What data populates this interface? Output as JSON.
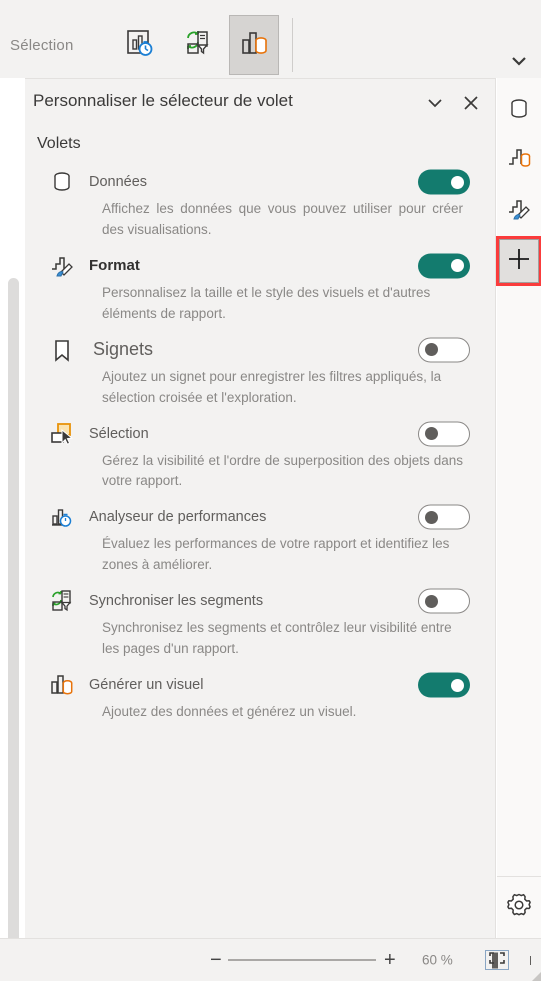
{
  "toolbar": {
    "label": "Sélection",
    "buttons": [
      {
        "name": "performance-analyzer-icon",
        "tooltip": "Analyseur de performances",
        "selected": false
      },
      {
        "name": "sync-slicers-icon",
        "tooltip": "Synchroniser les segments",
        "selected": false
      },
      {
        "name": "generate-visual-icon",
        "tooltip": "Générer un visuel",
        "selected": true
      }
    ],
    "collapse_chevron": "chevron-down-icon"
  },
  "panel": {
    "title": "Personnaliser le sélecteur de volet",
    "header_actions": [
      {
        "name": "collapse-icon",
        "glyph": "chevron-down"
      },
      {
        "name": "close-icon",
        "glyph": "close"
      }
    ],
    "section_title": "Volets",
    "panes": [
      {
        "id": "donnees",
        "label": "Données",
        "description": "Affichez les données que vous pouvez utiliser pour créer des visualisations.",
        "icon": "database-icon",
        "toggle": "on",
        "style": "normal"
      },
      {
        "id": "format",
        "label": "Format",
        "description": "Personnalisez la taille et le style des visuels et d'autres éléments de rapport.",
        "icon": "format-paintbrush-icon",
        "toggle": "on",
        "style": "bold"
      },
      {
        "id": "signets",
        "label": "Signets",
        "description": "Ajoutez un signet pour enregistrer les filtres appliqués, la sélection croisée et l'exploration.",
        "icon": "bookmark-icon",
        "toggle": "off",
        "style": "big"
      },
      {
        "id": "selection",
        "label": "Sélection",
        "description": "Gérez la visibilité et l'ordre de superposition des objets dans votre rapport.",
        "icon": "selection-cursor-icon",
        "toggle": "off",
        "style": "normal"
      },
      {
        "id": "analyseur",
        "label": "Analyseur de performances",
        "description": "Évaluez les performances de votre rapport et identifiez les zones à améliorer.",
        "icon": "performance-analyzer-icon",
        "toggle": "off",
        "style": "normal"
      },
      {
        "id": "sync-segments",
        "label": "Synchroniser les segments",
        "description": "Synchronisez les segments et contrôlez leur visibilité entre les pages d'un rapport.",
        "icon": "sync-slicers-icon",
        "toggle": "off",
        "style": "normal"
      },
      {
        "id": "generer-visuel",
        "label": "Générer un visuel",
        "description": "Ajoutez des données et générez un visuel.",
        "icon": "generate-visual-icon",
        "toggle": "on",
        "style": "normal"
      }
    ]
  },
  "rail": {
    "items": [
      {
        "name": "data-pane-icon",
        "label": "Données",
        "active": false
      },
      {
        "name": "generate-visual-pane-icon",
        "label": "Générer un visuel",
        "active": false
      },
      {
        "name": "format-pane-icon",
        "label": "Format",
        "active": false
      },
      {
        "name": "add-pane-button",
        "label": "+",
        "active": true
      }
    ],
    "settings": {
      "name": "gear-icon",
      "label": "Paramètres"
    }
  },
  "statusbar": {
    "zoom_out_label": "−",
    "zoom_in_label": "+",
    "zoom_value": "60 %",
    "fit_to_page_label": "Ajuster à la page"
  },
  "colors": {
    "toggle_on": "#137b6e",
    "highlight_border": "#fa3c3c",
    "chrome": "#f3f2f1",
    "rail": "#faf9f8",
    "text_muted": "#8a8886",
    "accent_orange": "#e8730a",
    "accent_blue": "#1b7fd4",
    "accent_green": "#2aa12a"
  }
}
